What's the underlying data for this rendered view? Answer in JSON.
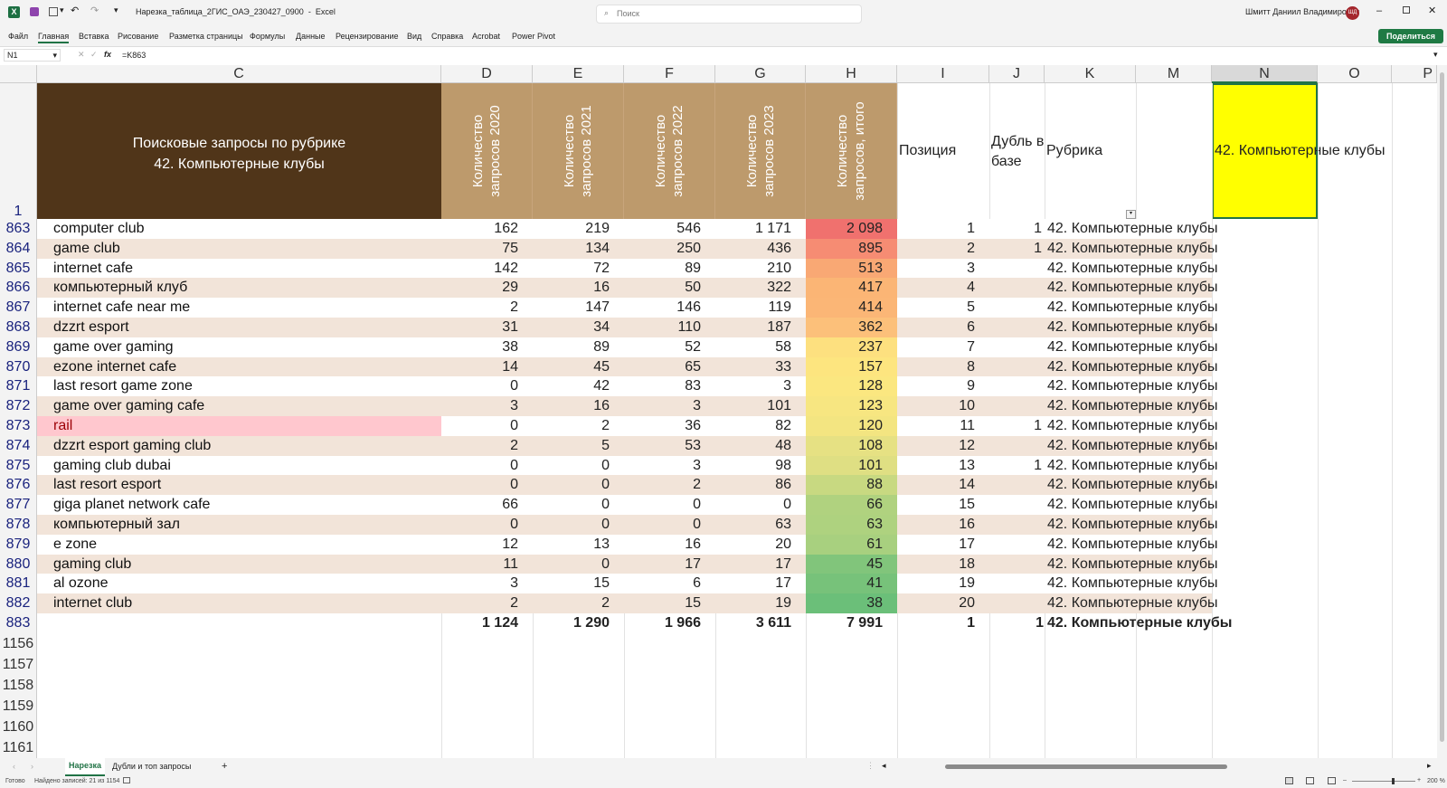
{
  "window": {
    "filename": "Нарезка_таблица_2ГИС_ОАЭ_230427_0900",
    "app": "Excel",
    "search_placeholder": "Поиск",
    "user": "Шмитт Даниил Владимирович",
    "user_initials": "ШД"
  },
  "ribbon": {
    "tabs": [
      "Файл",
      "Главная",
      "Вставка",
      "Рисование",
      "Разметка страницы",
      "Формулы",
      "Данные",
      "Рецензирование",
      "Вид",
      "Справка",
      "Acrobat",
      "Power Pivot"
    ],
    "share_label": "Поделиться"
  },
  "formula_bar": {
    "name_box": "N1",
    "fx": "fx",
    "formula": "=K863"
  },
  "columns": [
    "C",
    "D",
    "E",
    "F",
    "G",
    "H",
    "I",
    "J",
    "K",
    "M",
    "N",
    "O",
    "P"
  ],
  "header_row": {
    "row_number": "1",
    "title_line1": "Поисковые запросы по рубрике",
    "title_line2": "42. Компьютерные клубы",
    "d": "Количество запросов 2020",
    "e": "Количество запросов 2021",
    "f": "Количество запросов 2022",
    "g": "Количество запросов 2023",
    "h": "Количество запросов, итого",
    "i": "Позиция",
    "j": "Дубль в базе",
    "k": "Рубрика",
    "n": "42. Компьютерные клубы"
  },
  "rows": [
    {
      "n": "863",
      "c": "computer club",
      "d": "162",
      "e": "219",
      "f": "546",
      "g": "1 171",
      "h": "2 098",
      "i": "1",
      "j": "1",
      "k": "42. Компьютерные клубы"
    },
    {
      "n": "864",
      "c": "game club",
      "d": "75",
      "e": "134",
      "f": "250",
      "g": "436",
      "h": "895",
      "i": "2",
      "j": "1",
      "k": "42. Компьютерные клубы"
    },
    {
      "n": "865",
      "c": "internet cafe",
      "d": "142",
      "e": "72",
      "f": "89",
      "g": "210",
      "h": "513",
      "i": "3",
      "j": "",
      "k": "42. Компьютерные клубы"
    },
    {
      "n": "866",
      "c": "компьютерный клуб",
      "d": "29",
      "e": "16",
      "f": "50",
      "g": "322",
      "h": "417",
      "i": "4",
      "j": "",
      "k": "42. Компьютерные клубы"
    },
    {
      "n": "867",
      "c": "internet cafe near me",
      "d": "2",
      "e": "147",
      "f": "146",
      "g": "119",
      "h": "414",
      "i": "5",
      "j": "",
      "k": "42. Компьютерные клубы"
    },
    {
      "n": "868",
      "c": "dzzrt esport",
      "d": "31",
      "e": "34",
      "f": "110",
      "g": "187",
      "h": "362",
      "i": "6",
      "j": "",
      "k": "42. Компьютерные клубы"
    },
    {
      "n": "869",
      "c": "game over gaming",
      "d": "38",
      "e": "89",
      "f": "52",
      "g": "58",
      "h": "237",
      "i": "7",
      "j": "",
      "k": "42. Компьютерные клубы"
    },
    {
      "n": "870",
      "c": "ezone internet cafe",
      "d": "14",
      "e": "45",
      "f": "65",
      "g": "33",
      "h": "157",
      "i": "8",
      "j": "",
      "k": "42. Компьютерные клубы"
    },
    {
      "n": "871",
      "c": "last resort game zone",
      "d": "0",
      "e": "42",
      "f": "83",
      "g": "3",
      "h": "128",
      "i": "9",
      "j": "",
      "k": "42. Компьютерные клубы"
    },
    {
      "n": "872",
      "c": "game over gaming cafe",
      "d": "3",
      "e": "16",
      "f": "3",
      "g": "101",
      "h": "123",
      "i": "10",
      "j": "",
      "k": "42. Компьютерные клубы"
    },
    {
      "n": "873",
      "c": "rail",
      "d": "0",
      "e": "2",
      "f": "36",
      "g": "82",
      "h": "120",
      "i": "11",
      "j": "1",
      "k": "42. Компьютерные клубы",
      "highlight": "#ffc7ce"
    },
    {
      "n": "874",
      "c": "dzzrt esport gaming club",
      "d": "2",
      "e": "5",
      "f": "53",
      "g": "48",
      "h": "108",
      "i": "12",
      "j": "",
      "k": "42. Компьютерные клубы"
    },
    {
      "n": "875",
      "c": "gaming club dubai",
      "d": "0",
      "e": "0",
      "f": "3",
      "g": "98",
      "h": "101",
      "i": "13",
      "j": "1",
      "k": "42. Компьютерные клубы"
    },
    {
      "n": "876",
      "c": "last resort esport",
      "d": "0",
      "e": "0",
      "f": "2",
      "g": "86",
      "h": "88",
      "i": "14",
      "j": "",
      "k": "42. Компьютерные клубы"
    },
    {
      "n": "877",
      "c": "giga planet network cafe",
      "d": "66",
      "e": "0",
      "f": "0",
      "g": "0",
      "h": "66",
      "i": "15",
      "j": "",
      "k": "42. Компьютерные клубы"
    },
    {
      "n": "878",
      "c": "компьютерный зал",
      "d": "0",
      "e": "0",
      "f": "0",
      "g": "63",
      "h": "63",
      "i": "16",
      "j": "",
      "k": "42. Компьютерные клубы"
    },
    {
      "n": "879",
      "c": "e zone",
      "d": "12",
      "e": "13",
      "f": "16",
      "g": "20",
      "h": "61",
      "i": "17",
      "j": "",
      "k": "42. Компьютерные клубы"
    },
    {
      "n": "880",
      "c": "gaming club",
      "d": "11",
      "e": "0",
      "f": "17",
      "g": "17",
      "h": "45",
      "i": "18",
      "j": "",
      "k": "42. Компьютерные клубы"
    },
    {
      "n": "881",
      "c": "al ozone",
      "d": "3",
      "e": "15",
      "f": "6",
      "g": "17",
      "h": "41",
      "i": "19",
      "j": "",
      "k": "42. Компьютерные клубы"
    },
    {
      "n": "882",
      "c": "internet club",
      "d": "2",
      "e": "2",
      "f": "15",
      "g": "19",
      "h": "38",
      "i": "20",
      "j": "",
      "k": "42. Компьютерные клубы"
    }
  ],
  "heat_colors": [
    "#f0716e",
    "#f68c73",
    "#f9a874",
    "#fbb575",
    "#fbb676",
    "#fcc07a",
    "#fde07f",
    "#fde57f",
    "#fbe780",
    "#f7e681",
    "#f3e581",
    "#e6e183",
    "#dfdf83",
    "#c8d981",
    "#b0d27f",
    "#aed27f",
    "#a8d07f",
    "#81c57b",
    "#77c27a",
    "#6bbf79"
  ],
  "totals": {
    "n": "883",
    "d": "1 124",
    "e": "1 290",
    "f": "1 966",
    "g": "3 611",
    "h": "7 991",
    "i": "1",
    "j": "1",
    "k": "42. Компьютерные клубы"
  },
  "empty_rows": [
    "1156",
    "1157",
    "1158",
    "1159",
    "1160",
    "1161"
  ],
  "sheets": {
    "active": "Нарезка",
    "other": "Дубли и топ запросы"
  },
  "status": {
    "ready": "Готово",
    "found": "Найдено записей: 21 из 1154",
    "zoom": "200 %"
  },
  "colors": {
    "title_fill": "#503519",
    "header_fill": "#bd9a6c",
    "band_fill": "#f2e4d9",
    "selected_fill": "#ffff00",
    "excel_green": "#217346"
  }
}
